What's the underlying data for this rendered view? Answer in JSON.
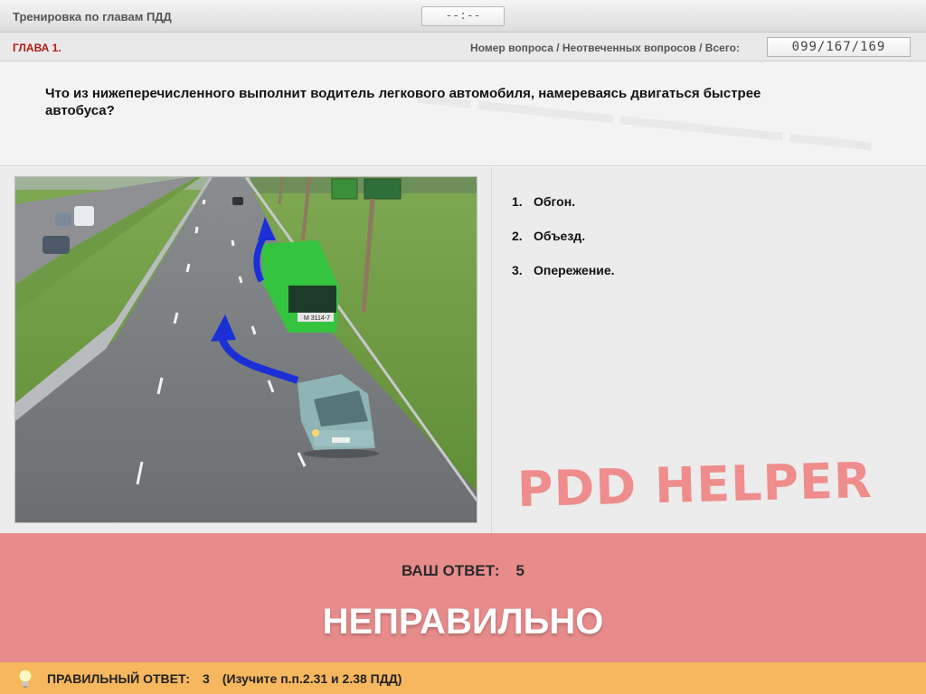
{
  "header": {
    "title": "Тренировка по главам ПДД",
    "timer": "--:--"
  },
  "chapter": {
    "label": "ГЛАВА 1.",
    "counter_label": "Номер вопроса / Неотвеченных вопросов / Всего:",
    "counter_value": "099/167/169"
  },
  "question": {
    "text": "Что из нижеперечисленного выполнит водитель легкового автомобиля, намереваясь двигаться быстрее автобуса?"
  },
  "image": {
    "bus_plate": "М 3114-7"
  },
  "answers": [
    {
      "num": "1.",
      "text": "Обгон."
    },
    {
      "num": "2.",
      "text": "Объезд."
    },
    {
      "num": "3.",
      "text": "Опережение."
    }
  ],
  "brand": "PDD HELPER",
  "result": {
    "your_answer_label": "ВАШ ОТВЕТ:",
    "your_answer_value": "5",
    "verdict": "НЕПРАВИЛЬНО"
  },
  "hint": {
    "icon": "lightbulb-icon",
    "label": "ПРАВИЛЬНЫЙ ОТВЕТ:",
    "value": "3",
    "reference": "(Изучите п.п.2.31 и 2.38 ПДД)"
  },
  "colors": {
    "chapter": "#b01818",
    "result_bg": "#e88b8b",
    "hint_bg": "#f7b75f",
    "brand": "#ef8c8c",
    "bus": "#35c43f",
    "arrow": "#1a2fd6"
  }
}
